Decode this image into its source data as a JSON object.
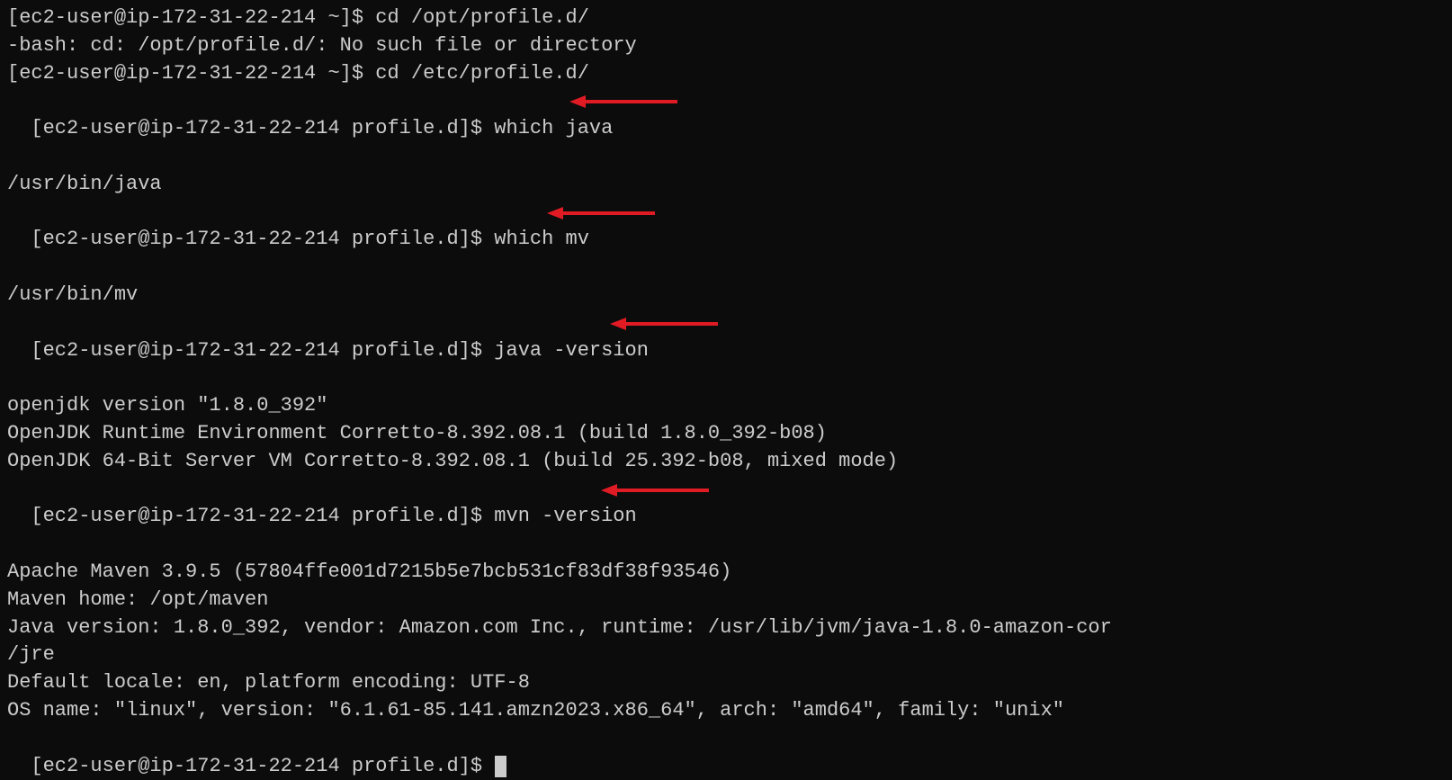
{
  "lines": {
    "l1": "[ec2-user@ip-172-31-22-214 ~]$ cd /opt/profile.d/",
    "l2": "-bash: cd: /opt/profile.d/: No such file or directory",
    "l3": "[ec2-user@ip-172-31-22-214 ~]$ cd /etc/profile.d/",
    "l4": "[ec2-user@ip-172-31-22-214 profile.d]$ which java",
    "l5": "/usr/bin/java",
    "l6": "[ec2-user@ip-172-31-22-214 profile.d]$ which mv",
    "l7": "/usr/bin/mv",
    "l8": "[ec2-user@ip-172-31-22-214 profile.d]$ java -version",
    "l9": "openjdk version \"1.8.0_392\"",
    "l10": "OpenJDK Runtime Environment Corretto-8.392.08.1 (build 1.8.0_392-b08)",
    "l11": "OpenJDK 64-Bit Server VM Corretto-8.392.08.1 (build 25.392-b08, mixed mode)",
    "l12": "[ec2-user@ip-172-31-22-214 profile.d]$ mvn -version",
    "l13": "Apache Maven 3.9.5 (57804ffe001d7215b5e7bcb531cf83df38f93546)",
    "l14": "Maven home: /opt/maven",
    "l15": "Java version: 1.8.0_392, vendor: Amazon.com Inc., runtime: /usr/lib/jvm/java-1.8.0-amazon-cor",
    "l16": "/jre",
    "l17": "Default locale: en, platform encoding: UTF-8",
    "l18": "OS name: \"linux\", version: \"6.1.61-85.141.amzn2023.x86_64\", arch: \"amd64\", family: \"unix\"",
    "l19": "[ec2-user@ip-172-31-22-214 profile.d]$ "
  },
  "arrows": {
    "color": "#e01b24"
  }
}
